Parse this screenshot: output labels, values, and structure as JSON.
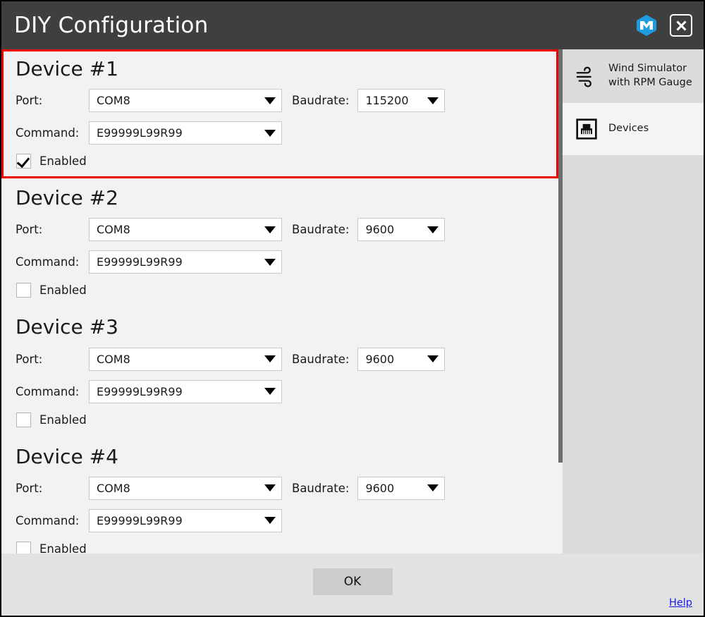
{
  "window": {
    "title": "DIY Configuration",
    "logo_icon": "hexagon-m-logo-icon",
    "close_icon": "close-icon",
    "accent_highlight_color": "#ee0000",
    "titlebar_color": "#3f3f3f",
    "link_color": "#1a1af0"
  },
  "labels": {
    "port": "Port:",
    "baudrate": "Baudrate:",
    "command": "Command:",
    "enabled": "Enabled"
  },
  "devices": [
    {
      "title": "Device #1",
      "port": "COM8",
      "baudrate": "115200",
      "command": "E99999L99R99",
      "enabled": true,
      "highlighted": true
    },
    {
      "title": "Device #2",
      "port": "COM8",
      "baudrate": "9600",
      "command": "E99999L99R99",
      "enabled": false,
      "highlighted": false
    },
    {
      "title": "Device #3",
      "port": "COM8",
      "baudrate": "9600",
      "command": "E99999L99R99",
      "enabled": false,
      "highlighted": false
    },
    {
      "title": "Device #4",
      "port": "COM8",
      "baudrate": "9600",
      "command": "E99999L99R99",
      "enabled": false,
      "highlighted": false
    }
  ],
  "sidebar": {
    "items": [
      {
        "label": "Wind Simulator\nwith RPM Gauge",
        "label_line1": "Wind Simulator",
        "label_line2": "with RPM Gauge",
        "icon": "wind-icon",
        "selected": true
      },
      {
        "label": "Devices",
        "icon": "ethernet-port-icon",
        "selected": false
      }
    ]
  },
  "footer": {
    "ok_label": "OK",
    "help_label": "Help"
  }
}
